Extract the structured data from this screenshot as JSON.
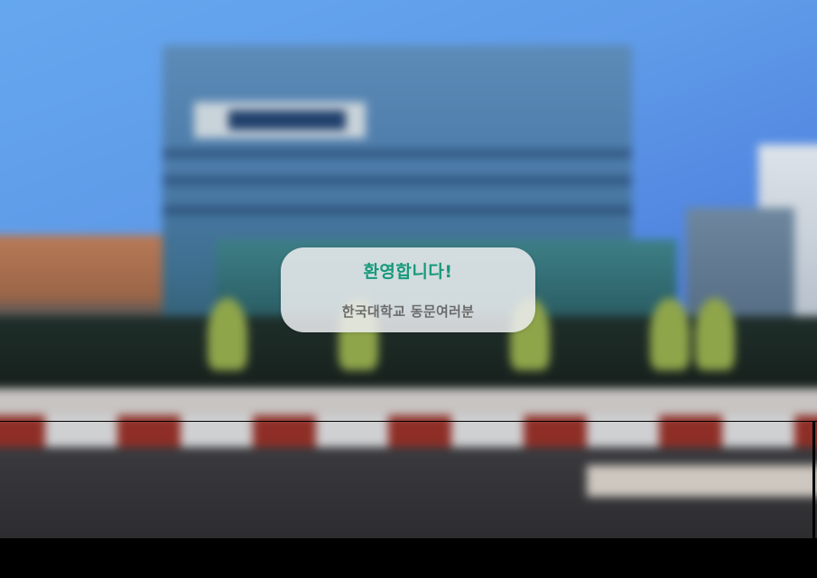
{
  "background": {
    "image": "blurred-campus-building-photo"
  },
  "welcome_card": {
    "title": "환영합니다!",
    "subtitle": "한국대학교 동문여러분",
    "title_color": "#16997a",
    "subtitle_color": "#6b6b6b"
  }
}
